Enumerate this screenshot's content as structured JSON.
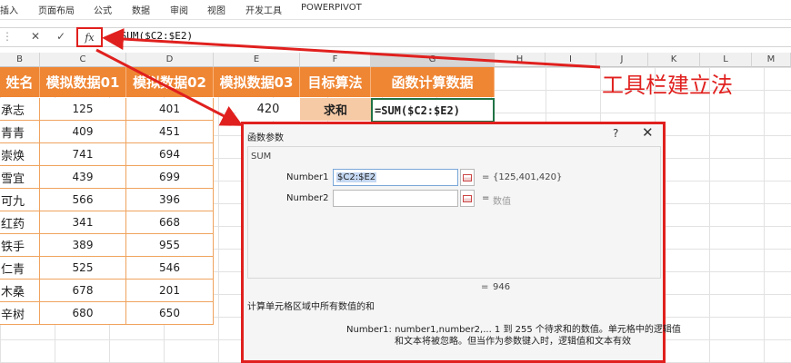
{
  "ribbon": {
    "tabs": [
      "插入",
      "页面布局",
      "公式",
      "数据",
      "审阅",
      "视图",
      "开发工具",
      "POWERPIVOT"
    ]
  },
  "formula_bar": {
    "cancel_icon": "✕",
    "enter_icon": "✓",
    "fx_label": "fx",
    "formula": "=SUM($C2:$E2)"
  },
  "columns": [
    "B",
    "C",
    "D",
    "E",
    "F",
    "G",
    "H",
    "I",
    "J",
    "K",
    "L",
    "M"
  ],
  "table": {
    "headers": [
      "姓名",
      "模拟数据01",
      "模拟数据02",
      "模拟数据03",
      "目标算法",
      "函数计算数据"
    ],
    "rows": [
      {
        "name": "承志",
        "c": "125",
        "d": "401"
      },
      {
        "name": "青青",
        "c": "409",
        "d": "451"
      },
      {
        "name": "崇焕",
        "c": "741",
        "d": "694"
      },
      {
        "name": "雪宜",
        "c": "439",
        "d": "699"
      },
      {
        "name": "可九",
        "c": "566",
        "d": "396"
      },
      {
        "name": "红药",
        "c": "341",
        "d": "668"
      },
      {
        "name": "铁手",
        "c": "389",
        "d": "955"
      },
      {
        "name": "仁青",
        "c": "525",
        "d": "546"
      },
      {
        "name": "木桑",
        "c": "678",
        "d": "201"
      },
      {
        "name": "辛树",
        "c": "680",
        "d": "650"
      }
    ],
    "e1": "420",
    "f1": "求和",
    "g1": "=SUM($C2:$E2)"
  },
  "annotation": "工具栏建立法",
  "dialog": {
    "title": "函数参数",
    "help": "?",
    "close": "✕",
    "function_name": "SUM",
    "number1_label": "Number1",
    "number1_value": "$C2:$E2",
    "number1_result": "{125,401,420}",
    "number2_label": "Number2",
    "number2_result": "数值",
    "eq": "=",
    "total": "946",
    "description": "计算单元格区域中所有数值的和",
    "arg_help_line1": "Number1:   number1,number2,...  1 到 255 个待求和的数值。单元格中的逻辑值",
    "arg_help_line2": "和文本将被忽略。但当作为参数键入时，逻辑值和文本有效"
  },
  "colors": {
    "header_orange": "#ef8634",
    "annotation_red": "#e0201e",
    "target_fill": "#f7caa6",
    "selection_green": "#217346"
  }
}
